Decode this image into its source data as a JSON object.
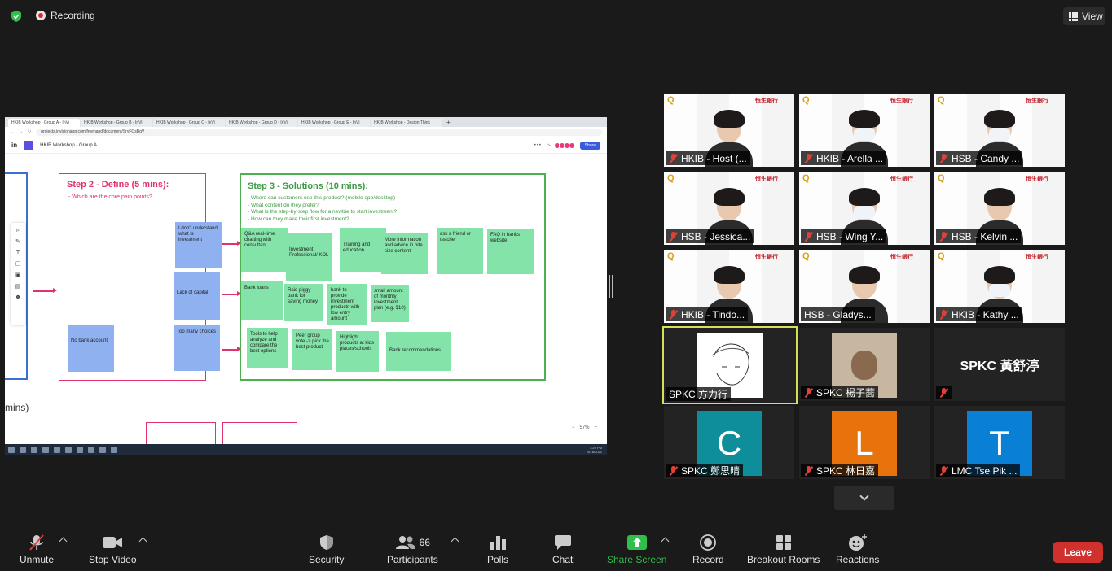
{
  "top": {
    "recording_label": "Recording",
    "view_label": "View"
  },
  "browser": {
    "tabs": [
      "HKIB Workshop - Group A - InVi",
      "HKIB Workshop - Group B - InVi",
      "HKIB Workshop - Group C - InVi",
      "HKIB Workshop - Group D - InVi",
      "HKIB Workshop - Group E - InVi",
      "HKIB Workshop - Design Think"
    ],
    "url": "projects.invisionapp.com/freehand/document/SryFQsBgV",
    "doc_title": "HKIB Workshop - Group A",
    "share_label": "Share",
    "clock_time": "3:29 PM",
    "clock_date": "5/16/2021"
  },
  "board": {
    "step2_title": "Step 2 - Define (5 mins):",
    "step2_sub": "- Which are the core pain points?",
    "step3_title": "Step 3 - Solutions (10 mins):",
    "step3_lines": [
      "- Where can customers use this product? (mobile app/desktop)",
      "- What content do they prefer?",
      "- What is the step-by-step flow for a newbie to start investment?",
      "- How can they make their first investment?"
    ],
    "blue_notes": [
      "I don't understand what is investment",
      "Lack of capital",
      "No bank account",
      "Too many choices"
    ],
    "green_notes": [
      "Q&A real-time chatting with consultant",
      "Investment Professional/ KOL",
      "Training and education",
      "More information and advice in bite size content",
      "ask a friend or teacher",
      "FAQ in banks website",
      "Bank loans",
      "Raid piggy bank for saving money",
      "bank to provide investment products with low entry amount",
      "small amount of monthly investment plan (e.g. $10)",
      "Tools to help analyze and compare the best options",
      "Peer group vote -> pick the best product",
      "Highlight products at kids places/schools",
      "Bank recommendations"
    ],
    "mins_label": "mins)",
    "zoom_label": "57%"
  },
  "participants": [
    {
      "name": "HKIB - Host (...",
      "muted": true
    },
    {
      "name": "HKIB - Arella ...",
      "muted": true
    },
    {
      "name": "HSB - Candy ...",
      "muted": true
    },
    {
      "name": "HSB - Jessica...",
      "muted": true
    },
    {
      "name": "HSB - Wing Y...",
      "muted": true
    },
    {
      "name": "HSB - Kelvin ...",
      "muted": true
    },
    {
      "name": "HKIB - Tindo...",
      "muted": true
    },
    {
      "name": "HSB - Gladys...",
      "muted": false
    },
    {
      "name": "HKIB - Kathy ...",
      "muted": true
    },
    {
      "name": "SPKC 方力行",
      "muted": false
    },
    {
      "name": "SPKC 楊子蕎",
      "muted": true
    },
    {
      "name": "SPKC 黃舒渟",
      "muted": true
    },
    {
      "name": "SPKC 鄭思晴",
      "muted": true,
      "initial": "C",
      "color": "#0e8d9a"
    },
    {
      "name": "SPKC 林日嘉",
      "muted": true,
      "initial": "L",
      "color": "#e8720c"
    },
    {
      "name": "LMC Tse Pik ...",
      "muted": true,
      "initial": "T",
      "color": "#0a7fd6"
    }
  ],
  "background_logo": {
    "bank_name_cn": "恒生銀行",
    "bank_name_en": "HANG SENG BANK"
  },
  "toolbar": {
    "unmute": "Unmute",
    "stop_video": "Stop Video",
    "security": "Security",
    "participants": "Participants",
    "participants_count": "66",
    "polls": "Polls",
    "chat": "Chat",
    "share_screen": "Share Screen",
    "record": "Record",
    "breakout_rooms": "Breakout Rooms",
    "reactions": "Reactions",
    "leave": "Leave"
  },
  "colors": {
    "active_speaker": "#d4e157",
    "share_green": "#2fbf4a",
    "leave_red": "#d0312d"
  }
}
